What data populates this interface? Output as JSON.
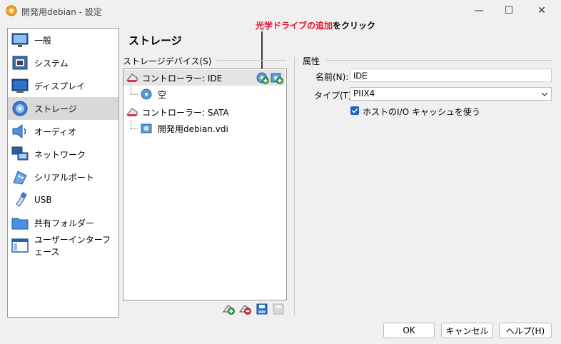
{
  "window": {
    "title": "開発用debian - 設定",
    "minimize_glyph": "—",
    "maximize_glyph": "☐",
    "close_glyph": "✕"
  },
  "annotation": {
    "highlight": "光学ドライブの追加",
    "suffix": "をクリック",
    "accent_color": "#e8112d"
  },
  "sidebar": {
    "items": [
      {
        "label": "一般",
        "icon": "general-icon"
      },
      {
        "label": "システム",
        "icon": "system-icon"
      },
      {
        "label": "ディスプレイ",
        "icon": "display-icon"
      },
      {
        "label": "ストレージ",
        "icon": "storage-icon",
        "selected": true
      },
      {
        "label": "オーディオ",
        "icon": "audio-icon"
      },
      {
        "label": "ネットワーク",
        "icon": "network-icon"
      },
      {
        "label": "シリアルポート",
        "icon": "serial-port-icon"
      },
      {
        "label": "USB",
        "icon": "usb-icon"
      },
      {
        "label": "共有フォルダー",
        "icon": "shared-folder-icon"
      },
      {
        "label": "ユーザーインターフェース",
        "icon": "user-interface-icon"
      }
    ]
  },
  "page": {
    "title": "ストレージ"
  },
  "storage_devices": {
    "label": "ストレージデバイス(S)",
    "tree": [
      {
        "label": "コントローラー: IDE",
        "type": "controller",
        "selected": true
      },
      {
        "label": "空",
        "type": "optical"
      },
      {
        "label": "コントローラー: SATA",
        "type": "controller"
      },
      {
        "label": "開発用debian.vdi",
        "type": "disk"
      }
    ]
  },
  "attributes": {
    "label": "属性",
    "name_label": "名前(N):",
    "name_value": "IDE",
    "type_label": "タイプ(T):",
    "type_value": "PIIX4",
    "cache_label": "ホストのI/O キャッシュを使う",
    "cache_checked": true
  },
  "buttons": {
    "ok": "OK",
    "cancel": "キャンセル",
    "help": "ヘルプ(H)"
  }
}
